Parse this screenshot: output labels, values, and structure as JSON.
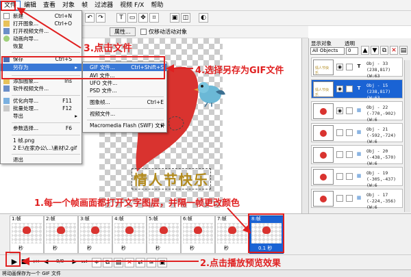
{
  "menubar": {
    "items": [
      "文件",
      "编辑",
      "查看",
      "对象",
      "帧",
      "过滤器",
      "视频 F/X",
      "帮助"
    ]
  },
  "toolbar": {
    "attr_label": "属性...",
    "move_active_label": "仅移动活动对象"
  },
  "file_menu": {
    "items": [
      {
        "label": "新建",
        "shortcut": "Ctrl+N"
      },
      {
        "label": "打开图象...",
        "shortcut": "Ctrl+O"
      },
      {
        "label": "打开视频文件...",
        "shortcut": ""
      },
      {
        "label": "动画向导...",
        "shortcut": ""
      },
      {
        "label": "恢复",
        "shortcut": ""
      },
      {
        "label": "保存",
        "shortcut": "Ctrl+S"
      },
      {
        "label": "另存为",
        "shortcut": ""
      },
      {
        "label": "添加图象...",
        "shortcut": "Ins"
      },
      {
        "label": "软件视频文件...",
        "shortcut": ""
      },
      {
        "label": "优化向导...",
        "shortcut": "F11"
      },
      {
        "label": "批量处理...",
        "shortcut": "F12"
      },
      {
        "label": "导出",
        "shortcut": ""
      },
      {
        "label": "参数选择...",
        "shortcut": "F6"
      },
      {
        "label": "1 帧.png",
        "shortcut": ""
      },
      {
        "label": "2 E:\\在家办公\\...\\素材\\2.gif",
        "shortcut": ""
      },
      {
        "label": "退出",
        "shortcut": ""
      }
    ]
  },
  "saveas_menu": {
    "items": [
      {
        "label": "GIF 文件...",
        "shortcut": "Ctrl+Shift+S"
      },
      {
        "label": "AVI 文件...",
        "shortcut": ""
      },
      {
        "label": "UFO 文件...",
        "shortcut": ""
      },
      {
        "label": "PSD 文件...",
        "shortcut": ""
      },
      {
        "label": "图象帧...",
        "shortcut": "Ctrl+E"
      },
      {
        "label": "视频文件...",
        "shortcut": ""
      },
      {
        "label": "Macromedia Flash (SWF) 文件",
        "shortcut": ""
      }
    ]
  },
  "canvas": {
    "title": "情人节快乐"
  },
  "right_panel": {
    "show_objects_label": "显示对象",
    "opacity_label": "透明",
    "filter_value": "All Objects",
    "opacity_value": "0",
    "objects": [
      {
        "name": "Obj - 33",
        "coords": "(238,817) (W:63"
      },
      {
        "name": "Obj - 15",
        "coords": "(238,817) (W:63"
      },
      {
        "name": "Obj - 22",
        "coords": "(-770,-902)(W:6"
      },
      {
        "name": "Obj - 21",
        "coords": "(-592,-724)(W:6"
      },
      {
        "name": "Obj - 20",
        "coords": "(-438,-570)(W:6"
      },
      {
        "name": "Obj - 19",
        "coords": "(-305,-437)(W:6"
      },
      {
        "name": "Obj - 17",
        "coords": "(-224,-356)(W:6"
      }
    ]
  },
  "frames": [
    {
      "label": "1:帧",
      "delay": "秒"
    },
    {
      "label": "2:帧",
      "delay": "秒"
    },
    {
      "label": "3:帧",
      "delay": "秒"
    },
    {
      "label": "4:帧",
      "delay": "秒"
    },
    {
      "label": "5:帧",
      "delay": "秒"
    },
    {
      "label": "6:帧",
      "delay": "秒"
    },
    {
      "label": "7:帧",
      "delay": "秒"
    },
    {
      "label": "8:帧",
      "delay": "0.1 秒"
    }
  ],
  "playbar": {
    "counter": "8/8"
  },
  "status": "将动画保存为一个 GIF 文件",
  "annotations": {
    "step1": "1.每一个帧画面都打开文字图层，并隔一帧更改颜色",
    "step2": "2.点击播放预览效果",
    "step3": "3.点击文件",
    "step4": "4.选择另存为GIF文件"
  },
  "colors": {
    "accent": "#1a63d4",
    "annotation": "#e02020",
    "heart": "#d9332f",
    "title_text": "#b28a1c"
  }
}
